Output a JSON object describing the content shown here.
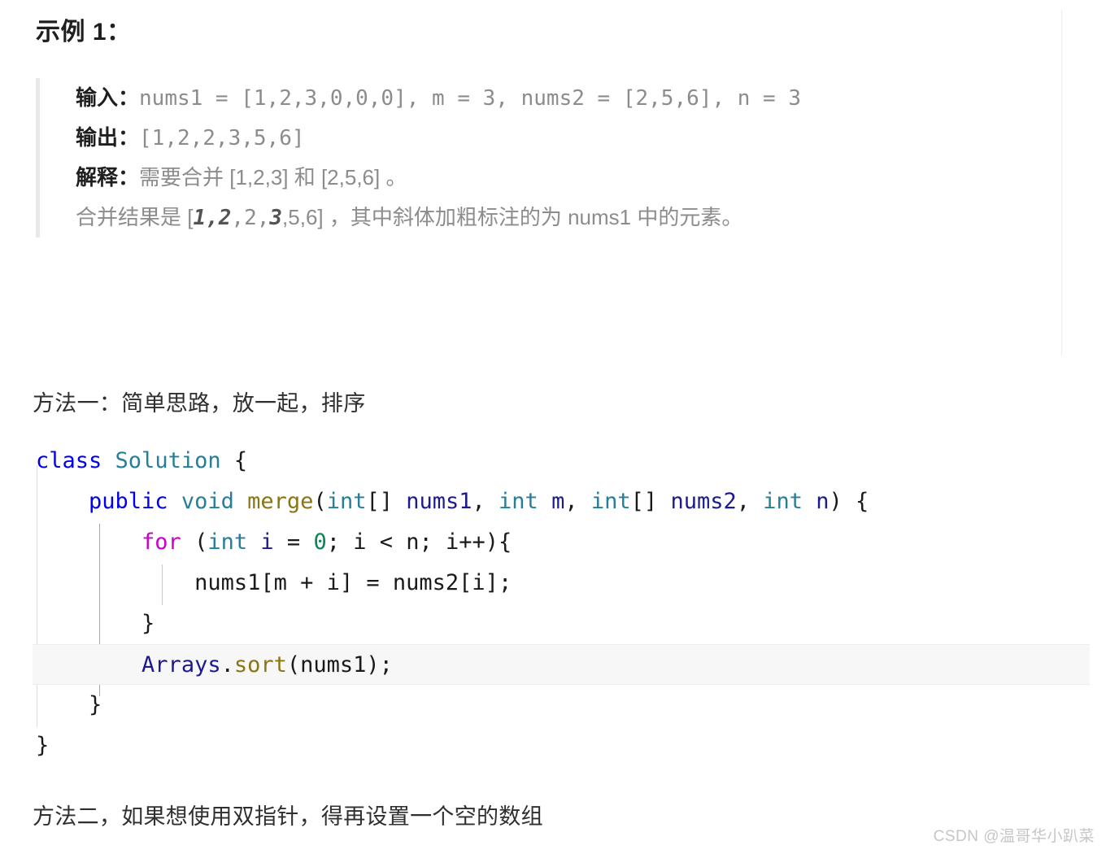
{
  "document": {
    "example_heading": "示例 1：",
    "blockquote": {
      "input_label": "输入：",
      "input_value": "nums1 = [1,2,3,0,0,0], m = 3, nums2 = [2,5,6], n = 3",
      "output_label": "输出：",
      "output_value": "[1,2,2,3,5,6]",
      "explain_label": "解释：",
      "explain_value": "需要合并 [1,2,3] 和 [2,5,6] 。",
      "explain_line2_prefix": "合并结果是 [",
      "explain_line2_bi1": "1,2",
      "explain_line2_mid": ",2,",
      "explain_line2_bi2": "3",
      "explain_line2_suffix": ",5,6] ，其中斜体加粗标注的为 nums1 中的元素。"
    },
    "method_one_note": "方法一：简单思路，放一起，排序",
    "method_two_note": "方法二，如果想使用双指针，得再设置一个空的数组",
    "code": {
      "language": "java",
      "highlighted_line_index": 5,
      "lines": [
        {
          "tokens": [
            {
              "t": "class",
              "c": "kw"
            },
            {
              "t": " ",
              "c": "plain"
            },
            {
              "t": "Solution",
              "c": "type"
            },
            {
              "t": " {",
              "c": "plain"
            }
          ]
        },
        {
          "tokens": [
            {
              "t": "    ",
              "c": "plain"
            },
            {
              "t": "public",
              "c": "kw"
            },
            {
              "t": " ",
              "c": "plain"
            },
            {
              "t": "void",
              "c": "type"
            },
            {
              "t": " ",
              "c": "plain"
            },
            {
              "t": "merge",
              "c": "fn"
            },
            {
              "t": "(",
              "c": "plain"
            },
            {
              "t": "int",
              "c": "type"
            },
            {
              "t": "[] ",
              "c": "plain"
            },
            {
              "t": "nums1",
              "c": "var"
            },
            {
              "t": ", ",
              "c": "plain"
            },
            {
              "t": "int",
              "c": "type"
            },
            {
              "t": " ",
              "c": "plain"
            },
            {
              "t": "m",
              "c": "var"
            },
            {
              "t": ", ",
              "c": "plain"
            },
            {
              "t": "int",
              "c": "type"
            },
            {
              "t": "[] ",
              "c": "plain"
            },
            {
              "t": "nums2",
              "c": "var"
            },
            {
              "t": ", ",
              "c": "plain"
            },
            {
              "t": "int",
              "c": "type"
            },
            {
              "t": " ",
              "c": "plain"
            },
            {
              "t": "n",
              "c": "var"
            },
            {
              "t": ") {",
              "c": "plain"
            }
          ]
        },
        {
          "tokens": [
            {
              "t": "        ",
              "c": "plain"
            },
            {
              "t": "for",
              "c": "ctl"
            },
            {
              "t": " (",
              "c": "plain"
            },
            {
              "t": "int",
              "c": "type"
            },
            {
              "t": " ",
              "c": "plain"
            },
            {
              "t": "i",
              "c": "var"
            },
            {
              "t": " = ",
              "c": "plain"
            },
            {
              "t": "0",
              "c": "num"
            },
            {
              "t": "; i < n; i++){",
              "c": "plain"
            }
          ]
        },
        {
          "tokens": [
            {
              "t": "            nums1[m + i] = nums2[i];",
              "c": "plain"
            }
          ]
        },
        {
          "tokens": [
            {
              "t": "        }",
              "c": "plain"
            }
          ]
        },
        {
          "tokens": [
            {
              "t": "        ",
              "c": "plain"
            },
            {
              "t": "Arrays",
              "c": "var"
            },
            {
              "t": ".",
              "c": "plain"
            },
            {
              "t": "sort",
              "c": "fn"
            },
            {
              "t": "(nums1);",
              "c": "plain"
            }
          ]
        },
        {
          "tokens": [
            {
              "t": "    }",
              "c": "plain"
            }
          ]
        },
        {
          "tokens": [
            {
              "t": "}",
              "c": "plain"
            }
          ]
        }
      ]
    },
    "watermark": "CSDN @温哥华小趴菜",
    "colors": {
      "keyword": "#0000ee",
      "type": "#267f99",
      "function": "#8a7512",
      "variable": "#1b1b8f",
      "control": "#cc00cc",
      "number": "#098658",
      "plain": "#1a1a1a",
      "quote_text": "#8c8c8c",
      "quote_border": "#e8e8e8",
      "highlight_bg": "#f7f7f7",
      "watermark": "#c6c6c6"
    }
  }
}
